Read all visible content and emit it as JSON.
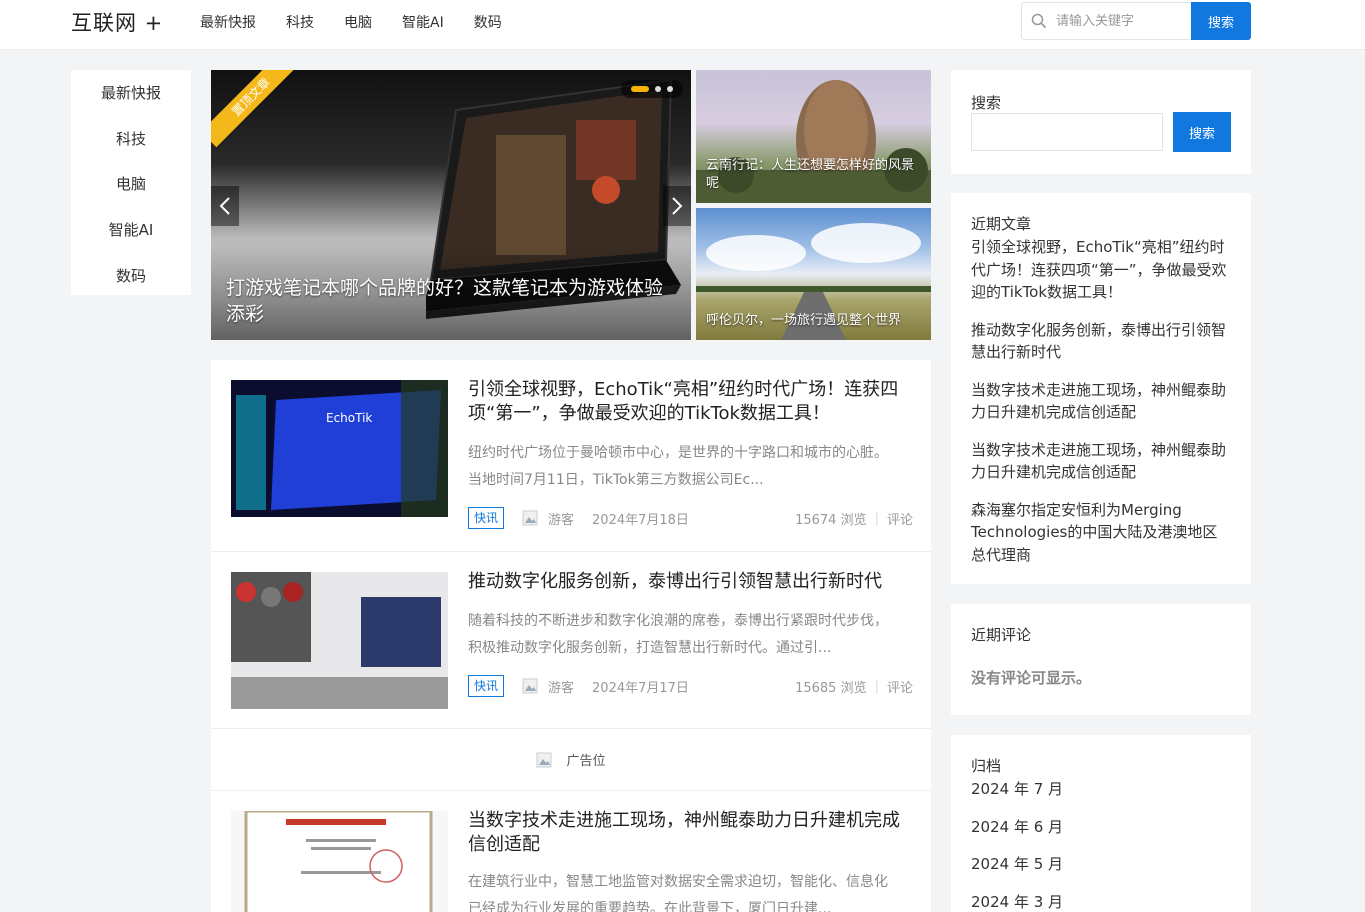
{
  "header": {
    "logo": "互联网 +",
    "nav": [
      "最新快报",
      "科技",
      "电脑",
      "智能AI",
      "数码"
    ],
    "search": {
      "placeholder": "请输入关键字",
      "button": "搜索"
    }
  },
  "category_nav": [
    "最新快报",
    "科技",
    "电脑",
    "智能AI",
    "数码"
  ],
  "slider": {
    "ribbon": "置顶文章",
    "caption": "打游戏笔记本哪个品牌的好？这款笔记本为游戏体验添彩",
    "dots": 3,
    "active_dot": 1
  },
  "side_thumbs": [
    {
      "caption": "云南行记：人生还想要怎样好的风景呢"
    },
    {
      "caption": "呼伦贝尔，一场旅行遇见整个世界"
    }
  ],
  "articles": [
    {
      "title": "引领全球视野，EchoTik“亮相”纽约时代广场！连获四项“第一”，争做最受欢迎的TikTok数据工具！",
      "desc": "纽约时代广场位于曼哈顿市中心，是世界的十字路口和城市的心脏。当地时间7月11日，TikTok第三方数据公司Ec...",
      "tag": "快讯",
      "author": "游客",
      "date": "2024年7月18日",
      "views": "15674 浏览",
      "comments": "评论"
    },
    {
      "title": "推动数字化服务创新，泰博出行引领智慧出行新时代",
      "desc": "随着科技的不断进步和数字化浪潮的席卷，泰博出行紧跟时代步伐，积极推动数字化服务创新，打造智慧出行新时代。通过引...",
      "tag": "快讯",
      "author": "游客",
      "date": "2024年7月17日",
      "views": "15685 浏览",
      "comments": "评论"
    },
    {
      "title": "当数字技术走进施工现场，神州鲲泰助力日升建机完成信创适配",
      "desc": "在建筑行业中，智慧工地监管对数据安全需求迫切，智能化、信息化已经成为行业发展的重要趋势。在此背景下，厦门日升建..."
    }
  ],
  "ad": {
    "text": "广告位"
  },
  "sidebar": {
    "search": {
      "title": "搜索",
      "button": "搜索"
    },
    "recent_posts": {
      "title": "近期文章",
      "items": [
        "引领全球视野，EchoTik“亮相”纽约时代广场！连获四项“第一”，争做最受欢迎的TikTok数据工具！",
        "推动数字化服务创新，泰博出行引领智慧出行新时代",
        "当数字技术走进施工现场，神州鲲泰助力日升建机完成信创适配",
        "当数字技术走进施工现场，神州鲲泰助力日升建机完成信创适配",
        "森海塞尔指定安恒利为Merging Technologies的中国大陆及港澳地区总代理商"
      ]
    },
    "recent_comments": {
      "title": "近期评论",
      "empty": "没有评论可显示。"
    },
    "archives": {
      "title": "归档",
      "items": [
        "2024 年 7 月",
        "2024 年 6 月",
        "2024 年 5 月",
        "2024 年 3 月"
      ]
    }
  },
  "colors": {
    "accent": "#1178e0",
    "ribbon": "#f5b81a",
    "dot_active": "#f5b400"
  }
}
